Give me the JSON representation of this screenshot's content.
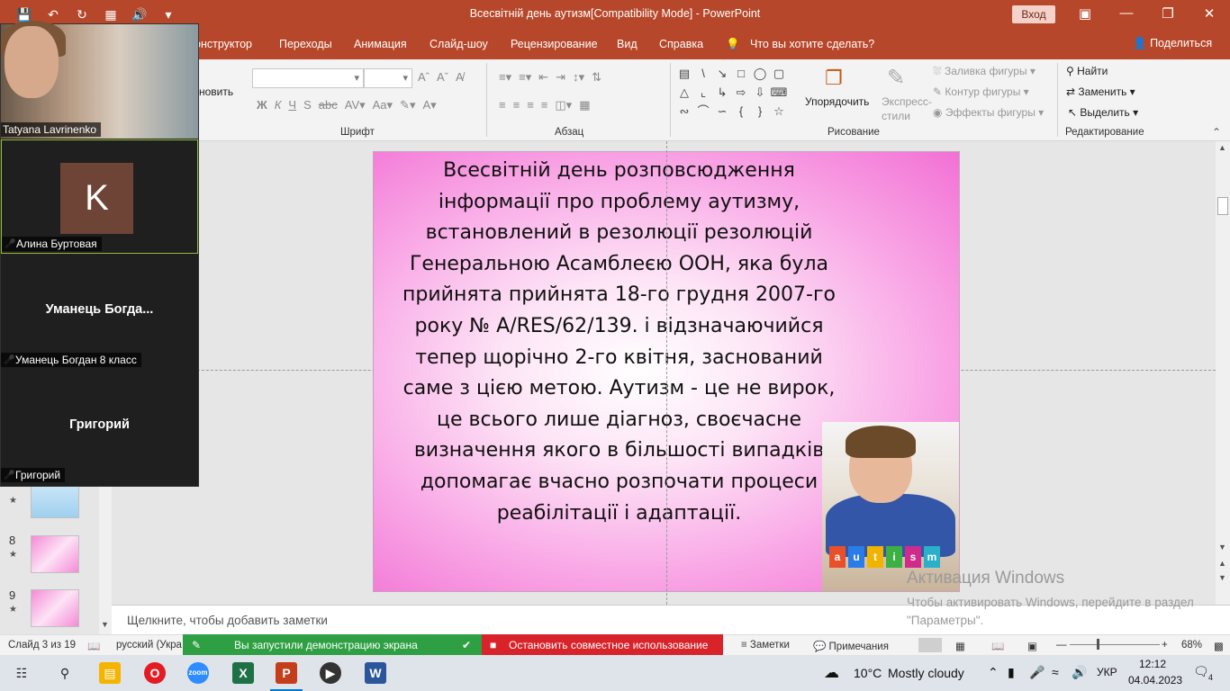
{
  "window": {
    "title": "Всесвітній день аутизм[Compatibility Mode]  -  PowerPoint",
    "login_label": "Вход"
  },
  "menu": {
    "tabs": [
      "онструктор",
      "Переходы",
      "Анимация",
      "Слайд-шоу",
      "Рецензирование",
      "Вид",
      "Справка"
    ],
    "tell_me": "Что вы хотите сделать?",
    "share": "Поделиться"
  },
  "ribbon": {
    "groups": {
      "font": "Шрифт",
      "paragraph": "Абзац",
      "drawing": "Рисование",
      "editing": "Редактирование"
    },
    "partial_button": "новить",
    "arrange": "Упорядочить",
    "quick_styles_1": "Экспресс-",
    "quick_styles_2": "стили",
    "shape_fill": "Заливка фигуры",
    "shape_outline": "Контур фигуры",
    "shape_effects": "Эффекты фигуры",
    "find": "Найти",
    "replace": "Заменить",
    "select": "Выделить"
  },
  "thumbnails": [
    {
      "number": "8"
    },
    {
      "number": "9"
    }
  ],
  "slide": {
    "text": "Всесвітній день розповсюдження інформації про проблему аутизму, встановлений в резолюції резолюцій Генеральною Асамблеєю ООН,  яка була прийнята прийнята 18-го грудня 2007-го року № A/RES/62/139. і відзначаючийся тепер щорічно 2-го квітня, заснований саме з цією метою. Аутизм - це не вирок, це всього лише діагноз, своєчасне визначення якого в більшості випадків допомагає вчасно розпочати процеси реабілітації і адаптації.",
    "image_blocks": [
      "a",
      "u",
      "t",
      "i",
      "s",
      "m"
    ]
  },
  "watermark": {
    "line1": "Активация Windows",
    "line2": "Чтобы активировать Windows, перейдите в раздел \"Параметры\"."
  },
  "notes": {
    "placeholder": "Щелкните, чтобы добавить заметки"
  },
  "statusbar": {
    "slide_info": "Слайд 3 из 19",
    "language": "русский (Укра",
    "sharing_started": "Вы запустили демонстрацию экрана",
    "stop_sharing": "Остановить совместное использование",
    "notes_btn": "Заметки",
    "comments_btn": "Примечания",
    "zoom": "68%"
  },
  "zoom_participants": [
    {
      "name": "Tatyana Lavrinenko",
      "type": "video"
    },
    {
      "name": "Алина Буртовая",
      "type": "avatar",
      "initial": "K",
      "muted": true,
      "active": true
    },
    {
      "name": "Уманець Богдан 8 класс",
      "display": "Уманець  Богда...",
      "muted": true
    },
    {
      "name": "Григорий",
      "display": "Григорий",
      "muted": true
    }
  ],
  "taskbar": {
    "weather_temp": "10°C",
    "weather_desc": "Mostly cloudy",
    "lang": "УКР",
    "time": "12:12",
    "date": "04.04.2023",
    "notification_count": "4"
  },
  "colors": {
    "powerpoint_accent": "#b7472a",
    "zoom_green": "#2ea043",
    "zoom_red": "#d8232a"
  }
}
